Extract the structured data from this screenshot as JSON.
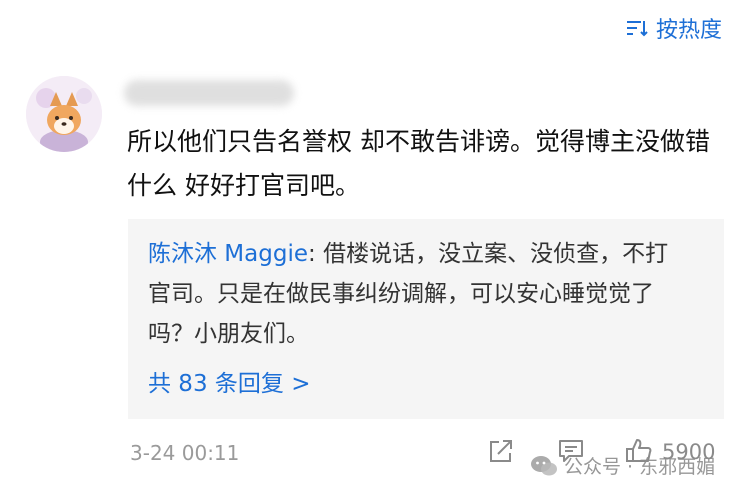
{
  "sort": {
    "label": "按热度",
    "icon": "sort-icon"
  },
  "comment": {
    "avatar_icon": "avatar-shiba-icon",
    "text": "所以他们只告名誉权 却不敢告诽谤。觉得博主没做错什么 好好打官司吧。",
    "time": "3-24 00:11",
    "like_count": "5900"
  },
  "reply": {
    "author": "陈沐沐 Maggie",
    "separator": ": ",
    "text": "借楼说话，没立案、没侦查，不打官司。只是在做民事纠纷调解，可以安心睡觉觉了吗？小朋友们。",
    "count_label": "共 83 条回复 >"
  },
  "actions": {
    "share_icon": "share-icon",
    "comment_icon": "comment-icon",
    "like_icon": "like-icon"
  },
  "watermark": {
    "text": "公众号 · 东邪西媚"
  },
  "colors": {
    "accent": "#1d6fd6",
    "reply_bg": "#f5f5f5",
    "muted": "#9a9a9a"
  }
}
